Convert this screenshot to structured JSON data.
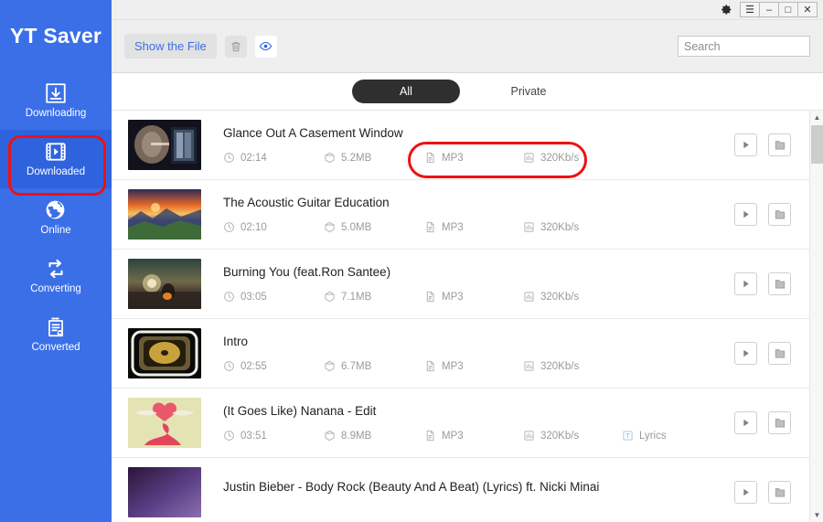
{
  "app": {
    "brand": "YT Saver"
  },
  "titlebar": {
    "gear_icon": "gear-icon",
    "menu_label": "☰",
    "minimize_label": "–",
    "maximize_label": "□",
    "close_label": "✕"
  },
  "toolbar": {
    "show_file_label": "Show the File",
    "delete_icon": "trash-icon",
    "preview_icon": "eye-icon",
    "search_placeholder": "Search",
    "search_value": ""
  },
  "sidebar": {
    "items": [
      {
        "label": "Downloading",
        "icon": "download-icon",
        "active": false
      },
      {
        "label": "Downloaded",
        "icon": "film-play-icon",
        "active": true
      },
      {
        "label": "Online",
        "icon": "globe-icon",
        "active": false
      },
      {
        "label": "Converting",
        "icon": "convert-icon",
        "active": false
      },
      {
        "label": "Converted",
        "icon": "document-sync-icon",
        "active": false
      }
    ]
  },
  "tabs": [
    {
      "label": "All",
      "active": true
    },
    {
      "label": "Private",
      "active": false
    }
  ],
  "list": {
    "rows": [
      {
        "title": "Glance Out A Casement Window",
        "duration": "02:14",
        "size": "5.2MB",
        "format": "MP3",
        "bitrate": "320Kb/s",
        "lyrics": "",
        "play_label": "play-button",
        "folder_label": "folder-button"
      },
      {
        "title": "The Acoustic Guitar Education",
        "duration": "02:10",
        "size": "5.0MB",
        "format": "MP3",
        "bitrate": "320Kb/s",
        "lyrics": "",
        "play_label": "play-button",
        "folder_label": "folder-button"
      },
      {
        "title": "Burning You (feat.Ron Santee)",
        "duration": "03:05",
        "size": "7.1MB",
        "format": "MP3",
        "bitrate": "320Kb/s",
        "lyrics": "",
        "play_label": "play-button",
        "folder_label": "folder-button"
      },
      {
        "title": "Intro",
        "duration": "02:55",
        "size": "6.7MB",
        "format": "MP3",
        "bitrate": "320Kb/s",
        "lyrics": "",
        "play_label": "play-button",
        "folder_label": "folder-button"
      },
      {
        "title": "(It Goes Like) Nanana - Edit",
        "duration": "03:51",
        "size": "8.9MB",
        "format": "MP3",
        "bitrate": "320Kb/s",
        "lyrics": "Lyrics",
        "play_label": "play-button",
        "folder_label": "folder-button"
      },
      {
        "title": "Justin Bieber - Body Rock (Beauty And A Beat) (Lyrics) ft. Nicki Minai",
        "duration": "",
        "size": "",
        "format": "",
        "bitrate": "",
        "lyrics": "",
        "play_label": "play-button",
        "folder_label": "folder-button"
      }
    ]
  },
  "annotations": [
    {
      "name": "highlight-downloaded",
      "color": "#EE1111"
    },
    {
      "name": "highlight-format-bitrate",
      "color": "#EE1111"
    }
  ],
  "colors": {
    "sidebar_blue": "#3A6FE8",
    "sidebar_active": "#2F63DE",
    "accent_link": "#3A6FE8",
    "tab_active_bg": "#2F2F2F",
    "annotation_red": "#EE1111"
  }
}
